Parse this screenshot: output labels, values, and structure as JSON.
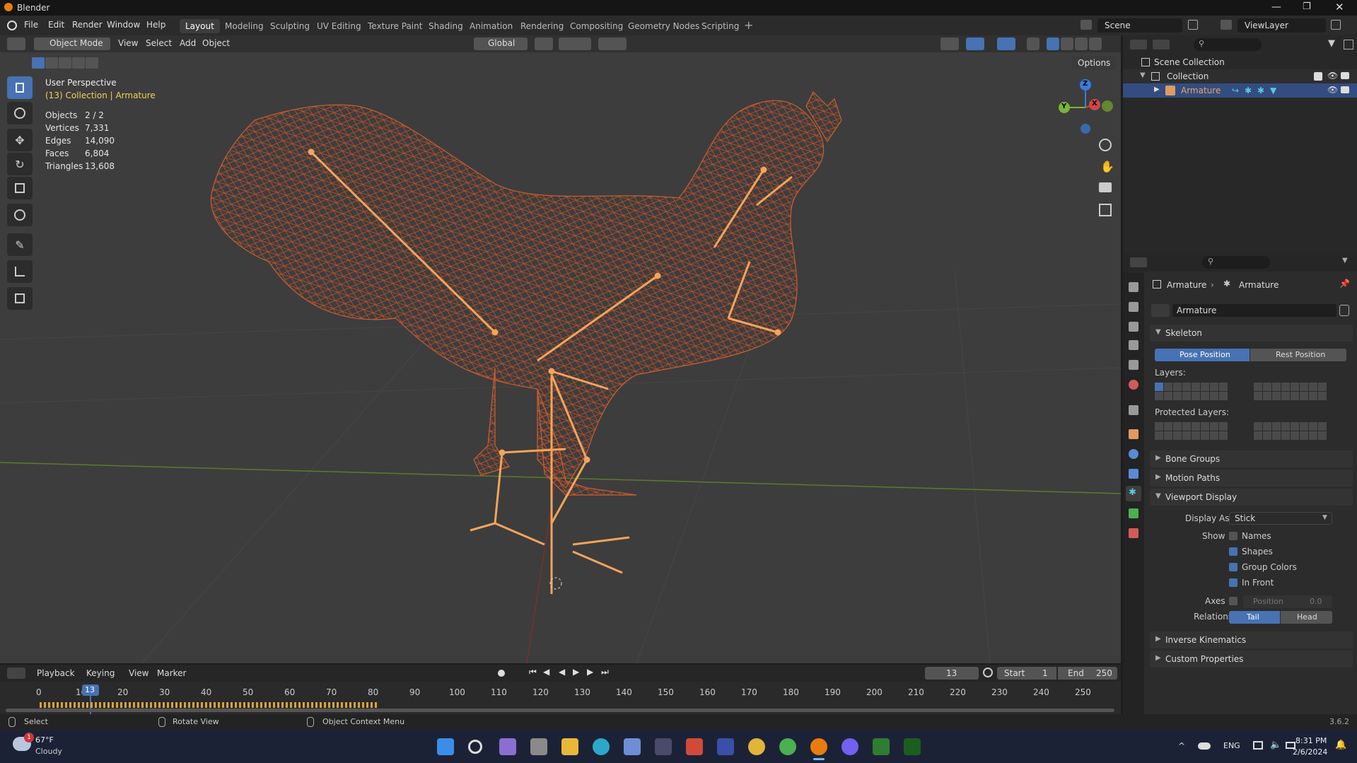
{
  "window": {
    "title": "Blender"
  },
  "menu": [
    "File",
    "Edit",
    "Render",
    "Window",
    "Help"
  ],
  "workspaces": [
    {
      "label": "Layout",
      "active": true
    },
    {
      "label": "Modeling"
    },
    {
      "label": "Sculpting"
    },
    {
      "label": "UV Editing"
    },
    {
      "label": "Texture Paint"
    },
    {
      "label": "Shading"
    },
    {
      "label": "Animation"
    },
    {
      "label": "Rendering"
    },
    {
      "label": "Compositing"
    },
    {
      "label": "Geometry Nodes"
    },
    {
      "label": "Scripting"
    }
  ],
  "scene": {
    "label": "Scene"
  },
  "viewlayer": {
    "label": "ViewLayer"
  },
  "viewport_header": {
    "mode": "Object Mode",
    "view": "View",
    "select": "Select",
    "add": "Add",
    "object": "Object",
    "orientation": "Global",
    "options": "Options"
  },
  "overlay_info": {
    "perspective": "User Perspective",
    "context": "(13) Collection | Armature"
  },
  "stats": [
    {
      "label": "Objects",
      "value": "2 / 2"
    },
    {
      "label": "Vertices",
      "value": "7,331"
    },
    {
      "label": "Edges",
      "value": "14,090"
    },
    {
      "label": "Faces",
      "value": "6,804"
    },
    {
      "label": "Triangles",
      "value": "13,608"
    }
  ],
  "gizmo": {
    "x": "X",
    "y": "Y",
    "z": "Z"
  },
  "outliner": {
    "scene_collection": "Scene Collection",
    "collection": "Collection",
    "armature": "Armature"
  },
  "properties": {
    "breadcrumb_object": "Armature",
    "breadcrumb_data": "Armature",
    "data_name": "Armature",
    "skeleton": "Skeleton",
    "pose_position": "Pose Position",
    "rest_position": "Rest Position",
    "layers": "Layers:",
    "protected_layers": "Protected Layers:",
    "bone_groups": "Bone Groups",
    "motion_paths": "Motion Paths",
    "viewport_display": "Viewport Display",
    "display_as_label": "Display As",
    "display_as_value": "Stick",
    "show_label": "Show",
    "names": "Names",
    "shapes": "Shapes",
    "group_colors": "Group Colors",
    "in_front": "In Front",
    "axes_label": "Axes",
    "position_label": "Position",
    "position_value": "0.0",
    "relations_label": "Relations",
    "tail": "Tail",
    "head": "Head",
    "inverse_kinematics": "Inverse Kinematics",
    "custom_properties": "Custom Properties"
  },
  "timeline": {
    "playback": "Playback",
    "keying": "Keying",
    "view": "View",
    "marker": "Marker",
    "current_frame": "13",
    "start_label": "Start",
    "start_value": "1",
    "end_label": "End",
    "end_value": "250",
    "ticks": [
      "0",
      "10",
      "20",
      "30",
      "40",
      "50",
      "60",
      "70",
      "80",
      "90",
      "100",
      "110",
      "120",
      "130",
      "140",
      "150",
      "160",
      "170",
      "180",
      "190",
      "200",
      "210",
      "220",
      "230",
      "240",
      "250"
    ]
  },
  "statusbar": {
    "select": "Select",
    "rotate": "Rotate View",
    "context_menu": "Object Context Menu",
    "version": "3.6.2"
  },
  "taskbar": {
    "weather_temp": "67°F",
    "weather_desc": "Cloudy",
    "weather_badge": "1",
    "lang": "ENG",
    "time": "8:31 PM",
    "date": "2/6/2024"
  }
}
